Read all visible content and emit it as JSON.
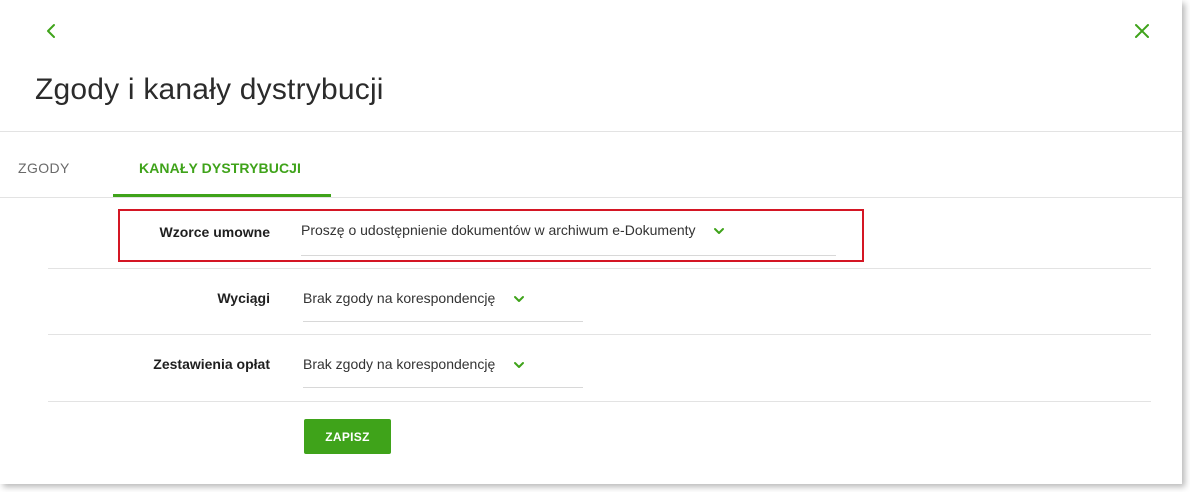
{
  "header": {
    "title": "Zgody i kanały dystrybucji",
    "back_icon": "chevron-left-icon",
    "close_icon": "close-icon"
  },
  "tabs": [
    {
      "label": "ZGODY",
      "active": false
    },
    {
      "label": "KANAŁY DYSTRYBUCJI",
      "active": true
    }
  ],
  "form": {
    "rows": [
      {
        "label": "Wzorce umowne",
        "value": "Proszę o udostępnienie dokumentów w archiwum e-Dokumenty",
        "highlighted": true
      },
      {
        "label": "Wyciągi",
        "value": "Brak zgody na korespondencję"
      },
      {
        "label": "Zestawienia opłat",
        "value": "Brak zgody na korespondencję"
      }
    ],
    "save_label": "ZAPISZ"
  },
  "colors": {
    "accent": "#3fa31a",
    "highlight_border": "#d41624"
  }
}
